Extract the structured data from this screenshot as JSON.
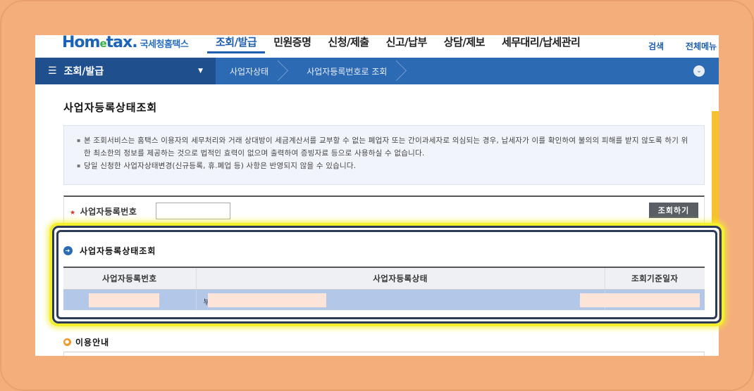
{
  "header": {
    "logo_main": "Hom",
    "logo_e": "e",
    "logo_tail": "tax.",
    "logo_sub": "국세청홈택스",
    "gnb": [
      "조회/발급",
      "민원증명",
      "신청/제출",
      "신고/납부",
      "상담/제보",
      "세무대리/납세관리"
    ],
    "util": [
      {
        "label": "검색",
        "icon": "search-icon"
      },
      {
        "label": "전체메뉴",
        "icon": "menu-dots-icon"
      }
    ]
  },
  "navbar": {
    "menu_title": "조회/발급",
    "crumbs": [
      "사업자상태",
      "사업자등록번호로 조회"
    ]
  },
  "page": {
    "title": "사업자등록상태조회",
    "notice_lines": [
      "본 조회서비스는 홈택스 이용자의 세무처리와 거래 상대방이 세금계산서를 교부할 수 없는 폐업자 또는 간이과세자로 의심되는 경우, 납세자가 이를 확인하여 불의의 피해를 받지 않도록 하기 위한 최소한의 정보를 제공하는 것으로 법적인 효력이 없으며 출력하여 증빙자료 등으로 사용하실 수 없습니다.",
      "당일 신청한 사업자상태변경(신규등록, 휴.폐업 등) 사항은 반영되지 않을 수 있습니다."
    ]
  },
  "search": {
    "label": "사업자등록번호",
    "input_value": "",
    "button": "조회하기"
  },
  "result": {
    "title": "사업자등록상태조회",
    "columns": [
      "사업자등록번호",
      "사업자등록상태",
      "조회기준일자"
    ],
    "row_prefix": "부"
  },
  "guide": {
    "title": "이용안내"
  },
  "colors": {
    "accent": "#2c6ab3",
    "highlight": "#f4ef2c",
    "background": "#f4ae7c"
  }
}
